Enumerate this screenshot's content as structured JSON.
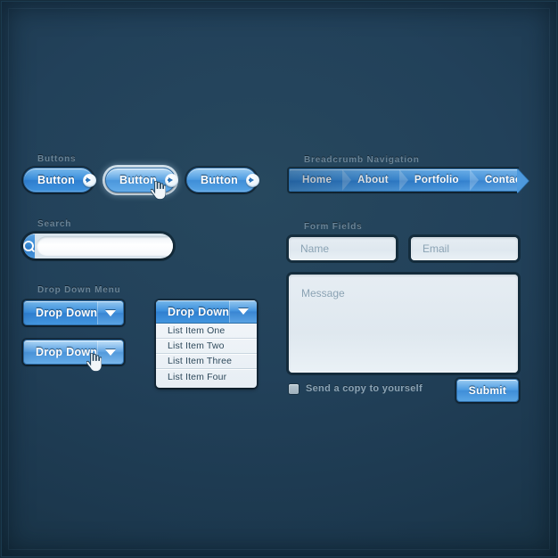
{
  "theme": {
    "background": "#1d3b50",
    "accent": "#398edd",
    "label_color": "#6a8497",
    "field_bg": "#e6edf3",
    "text_on_accent": "#ffffff"
  },
  "sections": {
    "buttons_label": "Buttons",
    "search_label": "Search",
    "dropdown_label": "Drop Down Menu",
    "breadcrumb_label": "Breadcrumb Navigation",
    "form_label": "Form Fields"
  },
  "buttons": [
    {
      "label": "Button",
      "state": "normal",
      "icon": "arrow-right-circle-icon"
    },
    {
      "label": "Button",
      "state": "hover",
      "icon": "arrow-right-circle-icon"
    },
    {
      "label": "Button",
      "state": "active",
      "icon": "arrow-right-circle-icon"
    }
  ],
  "breadcrumb": {
    "items": [
      {
        "label": "Home"
      },
      {
        "label": "About"
      },
      {
        "label": "Portfolio"
      },
      {
        "label": "Contact"
      }
    ]
  },
  "search": {
    "icon": "search-icon",
    "value": "",
    "placeholder": ""
  },
  "dropdowns": [
    {
      "label": "Drop Down",
      "state": "normal",
      "caret": "chevron-down-icon"
    },
    {
      "label": "Drop Down",
      "state": "hover",
      "caret": "chevron-down-icon"
    }
  ],
  "dropdown_open": {
    "label": "Drop Down",
    "caret": "chevron-down-icon",
    "items": [
      "List Item One",
      "List Item Two",
      "List Item Three",
      "List Item Four"
    ]
  },
  "form": {
    "name_value": "",
    "name_placeholder": "Name",
    "email_value": "",
    "email_placeholder": "Email",
    "message_value": "",
    "message_placeholder": "Message",
    "checkbox_label": "Send a copy to yourself",
    "checkbox_checked": false,
    "submit_label": "Submit"
  },
  "cursors": [
    {
      "name": "pointer-hand-cursor",
      "on": "button-hover"
    },
    {
      "name": "pointer-hand-cursor",
      "on": "dropdown-hover"
    }
  ]
}
